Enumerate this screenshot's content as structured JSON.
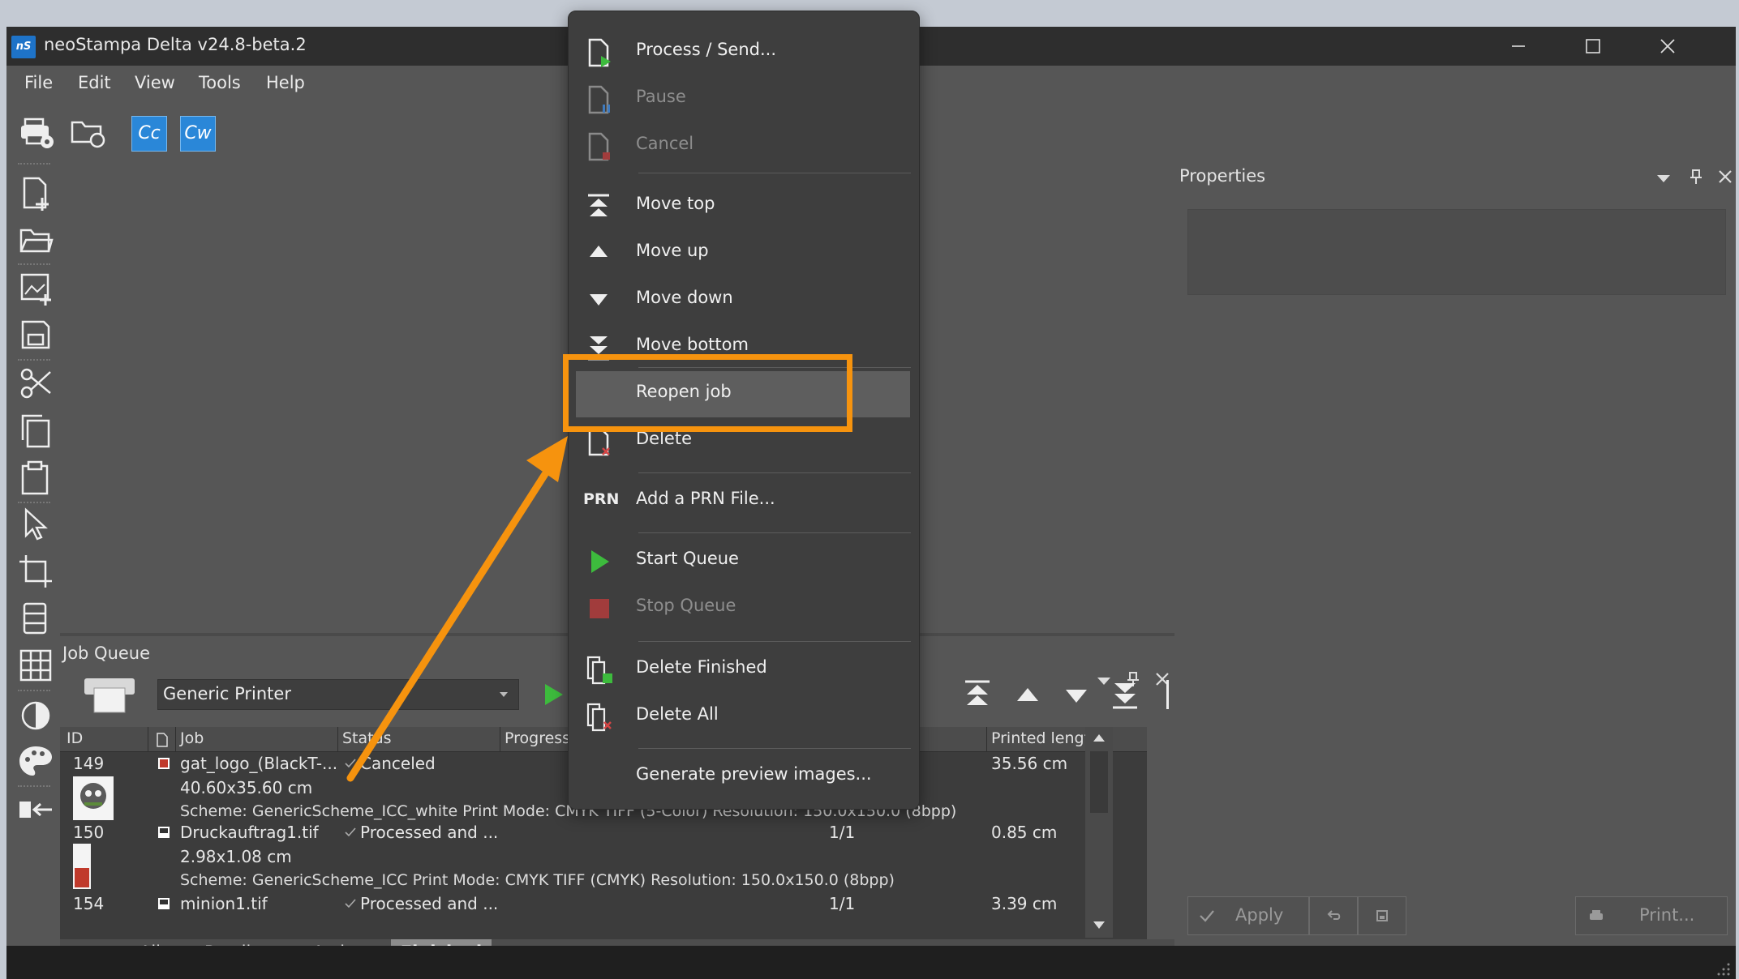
{
  "window": {
    "app_logo": "nS",
    "title": "neoStampa Delta  v24.8-beta.2"
  },
  "menubar": [
    "File",
    "Edit",
    "View",
    "Tools",
    "Help"
  ],
  "toolbar": {
    "cc_label": "Cc",
    "cw_label": "Cw"
  },
  "properties": {
    "title": "Properties",
    "apply_label": "Apply",
    "print_label": "Print..."
  },
  "job_queue": {
    "title": "Job Queue",
    "printer": "Generic Printer",
    "columns": [
      "ID",
      "Job",
      "Status",
      "Progress",
      "Printed length"
    ],
    "rows": [
      {
        "id": "149",
        "job": "gat_logo_(BlackT-...",
        "status": "Canceled",
        "progress": "",
        "printed_length": "35.56 cm",
        "size": "40.60x35.60 cm",
        "details": "Scheme: GenericScheme_ICC_white  Print Mode: CMYK TIFF (5-Color)  Resolution: 150.0x150.0 (8bpp)"
      },
      {
        "id": "150",
        "job": "Druckauftrag1.tif",
        "status": "Processed and ...",
        "progress": "1/1",
        "printed_length": "0.85 cm",
        "size": "2.98x1.08 cm",
        "details": "Scheme: GenericScheme_ICC  Print Mode: CMYK TIFF (CMYK)  Resolution: 150.0x150.0 (8bpp)"
      },
      {
        "id": "154",
        "job": "minion1.tif",
        "status": "Processed and ...",
        "progress": "1/1",
        "printed_length": "3.39 cm"
      }
    ],
    "tabs": [
      "All",
      "Pending",
      "Active",
      "Finished"
    ],
    "active_tab": "Finished"
  },
  "context_menu": {
    "items": {
      "process": "Process / Send...",
      "pause": "Pause",
      "cancel": "Cancel",
      "move_top": "Move top",
      "move_up": "Move up",
      "move_down": "Move down",
      "move_bottom": "Move bottom",
      "reopen": "Reopen job",
      "delete": "Delete",
      "add_prn_icon": "PRN",
      "add_prn": "Add a PRN File...",
      "start_queue": "Start Queue",
      "stop_queue": "Stop Queue",
      "delete_finished": "Delete Finished",
      "delete_all": "Delete All",
      "generate_previews": "Generate preview images..."
    }
  },
  "colors": {
    "highlight": "#f6930e",
    "start_green": "#3dbb3d",
    "stop_red": "#a13c3c",
    "window_bg": "#565656"
  }
}
